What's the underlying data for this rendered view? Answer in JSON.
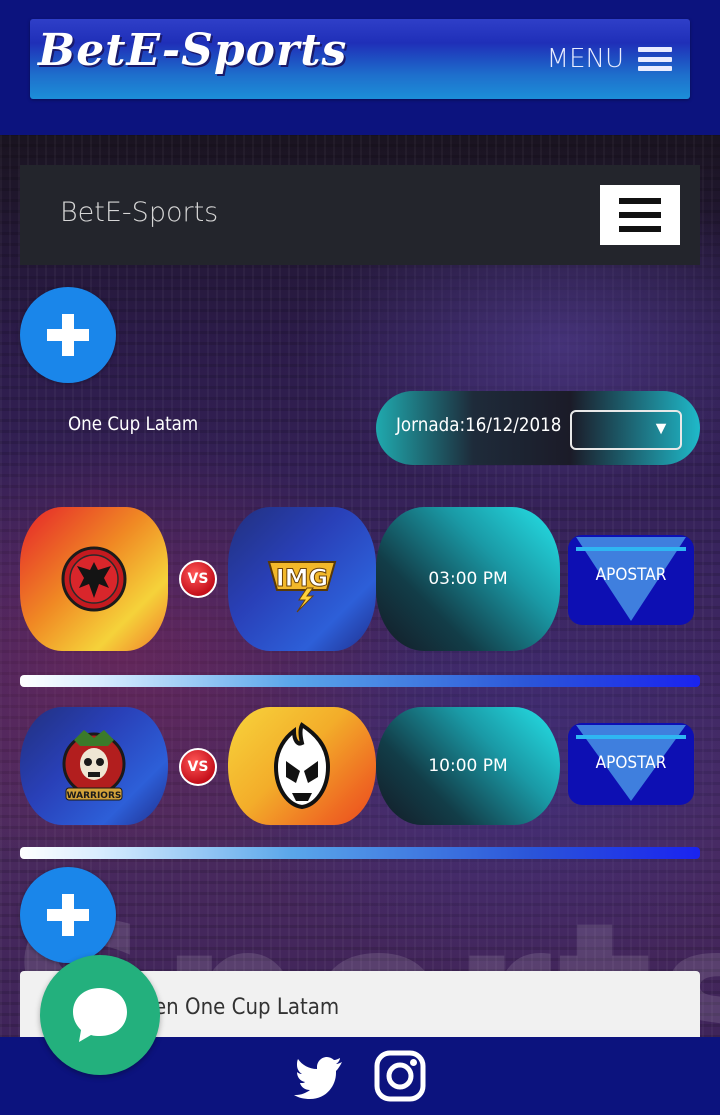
{
  "header": {
    "logo_text": "BetE-Sports",
    "menu_label": "MENU"
  },
  "navbar": {
    "brand": "BetE-Sports"
  },
  "league": {
    "tournament": "One Cup Latam",
    "jornada_label": "Jornada:16/12/2018",
    "jornada_select_value": ""
  },
  "matches": [
    {
      "home_icon": "bat-logo-icon",
      "away_icon": "img-lightning-logo-icon",
      "vs": "VS",
      "time": "03:00 PM",
      "bet_label": "APOSTAR"
    },
    {
      "home_icon": "warriors-skull-logo-icon",
      "away_icon": "flame-mask-logo-icon",
      "vs": "VS",
      "time": "10:00 PM",
      "bet_label": "APOSTAR"
    }
  ],
  "card": {
    "title": "en One Cup Latam"
  },
  "footer": {
    "icons": [
      "twitter-icon",
      "instagram-icon"
    ]
  },
  "colors": {
    "header_bg": "#0c137e",
    "plus_button": "#1a86ea",
    "bet_button": "#0d0fb3",
    "chat_button": "#23b07d"
  }
}
